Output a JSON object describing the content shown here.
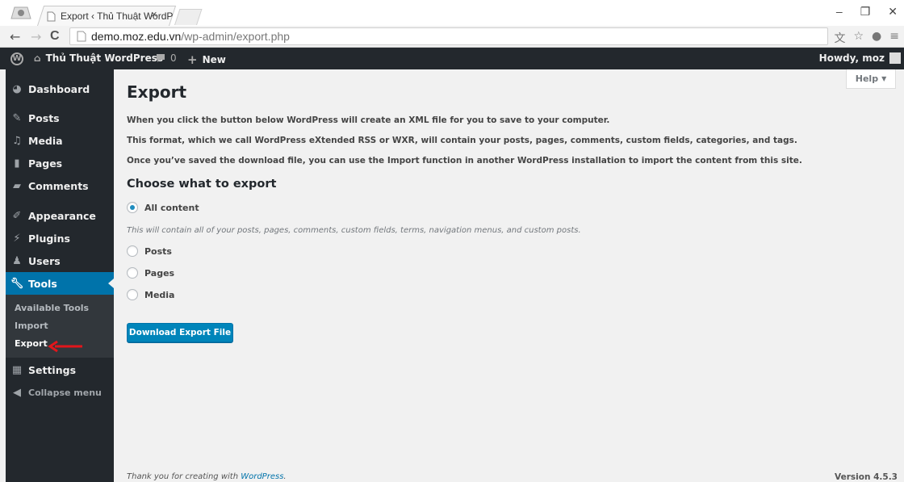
{
  "browser": {
    "tab_title": "Export ‹ Thủ Thuật WordP",
    "tab_close": "×",
    "url_host": "demo.moz.edu.vn",
    "url_path": "/wp-admin/export.php",
    "back": "←",
    "forward": "→",
    "reload": "C"
  },
  "adminbar": {
    "site_name": "Thủ Thuật WordPress",
    "comments_count": "0",
    "new_label": "New",
    "howdy": "Howdy, moz"
  },
  "sidebar": {
    "items": [
      {
        "label": "Dashboard",
        "icon": "dashboard-icon"
      },
      {
        "label": "Posts",
        "icon": "pin-icon"
      },
      {
        "label": "Media",
        "icon": "media-icon"
      },
      {
        "label": "Pages",
        "icon": "page-icon"
      },
      {
        "label": "Comments",
        "icon": "comment-icon"
      },
      {
        "label": "Appearance",
        "icon": "brush-icon"
      },
      {
        "label": "Plugins",
        "icon": "plug-icon"
      },
      {
        "label": "Users",
        "icon": "user-icon"
      },
      {
        "label": "Tools",
        "icon": "wrench-icon"
      },
      {
        "label": "Settings",
        "icon": "settings-icon"
      }
    ],
    "submenu": [
      "Available Tools",
      "Import",
      "Export"
    ],
    "collapse": "Collapse menu"
  },
  "main": {
    "help": "Help",
    "title": "Export",
    "p1": "When you click the button below WordPress will create an XML file for you to save to your computer.",
    "p2": "This format, which we call WordPress eXtended RSS or WXR, will contain your posts, pages, comments, custom fields, categories, and tags.",
    "p3": "Once you’ve saved the download file, you can use the Import function in another WordPress installation to import the content from this site.",
    "choose_heading": "Choose what to export",
    "options": [
      "All content",
      "Posts",
      "Pages",
      "Media"
    ],
    "all_desc": "This will contain all of your posts, pages, comments, custom fields, terms, navigation menus, and custom posts.",
    "download_button": "Download Export File",
    "footer_text": "Thank you for creating with ",
    "footer_link": "WordPress",
    "footer_end": ".",
    "version": "Version 4.5.3"
  },
  "colors": {
    "accent": "#0073aa",
    "primary_button": "#0085ba",
    "sidebar_bg": "#23282d",
    "arrow": "#e3161b"
  }
}
